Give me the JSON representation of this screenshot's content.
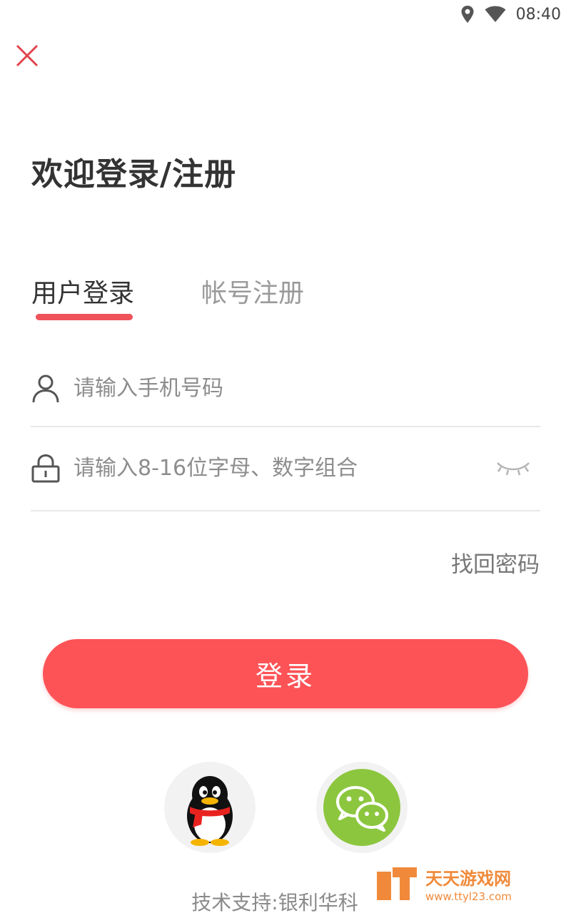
{
  "status_bar": {
    "time": "08:40",
    "icons": [
      "location-icon",
      "wifi-icon"
    ]
  },
  "close": {
    "icon": "close-icon",
    "color": "#e0454d"
  },
  "title": "欢迎登录/注册",
  "tabs": [
    {
      "label": "用户登录",
      "active": true
    },
    {
      "label": "帐号注册",
      "active": false
    }
  ],
  "form": {
    "phone": {
      "placeholder": "请输入手机号码",
      "value": "",
      "icon": "user-icon"
    },
    "password": {
      "placeholder": "请输入8-16位字母、数字组合",
      "value": "",
      "icon": "lock-icon",
      "toggle_icon": "eye-closed-icon"
    },
    "forgot_label": "找回密码",
    "submit_label": "登录"
  },
  "social_login": [
    {
      "name": "qq",
      "icon": "qq-penguin-icon"
    },
    {
      "name": "wechat",
      "icon": "wechat-icon",
      "color": "#8cc63e"
    }
  ],
  "footer": "技术支持:银利华科",
  "watermark": {
    "name": "天天游戏网",
    "url": "www.ttyl23.com"
  },
  "colors": {
    "accent": "#fd5357",
    "tab_indicator": "#f0525a",
    "text_primary": "#333333",
    "text_secondary": "#8d8d8d"
  }
}
